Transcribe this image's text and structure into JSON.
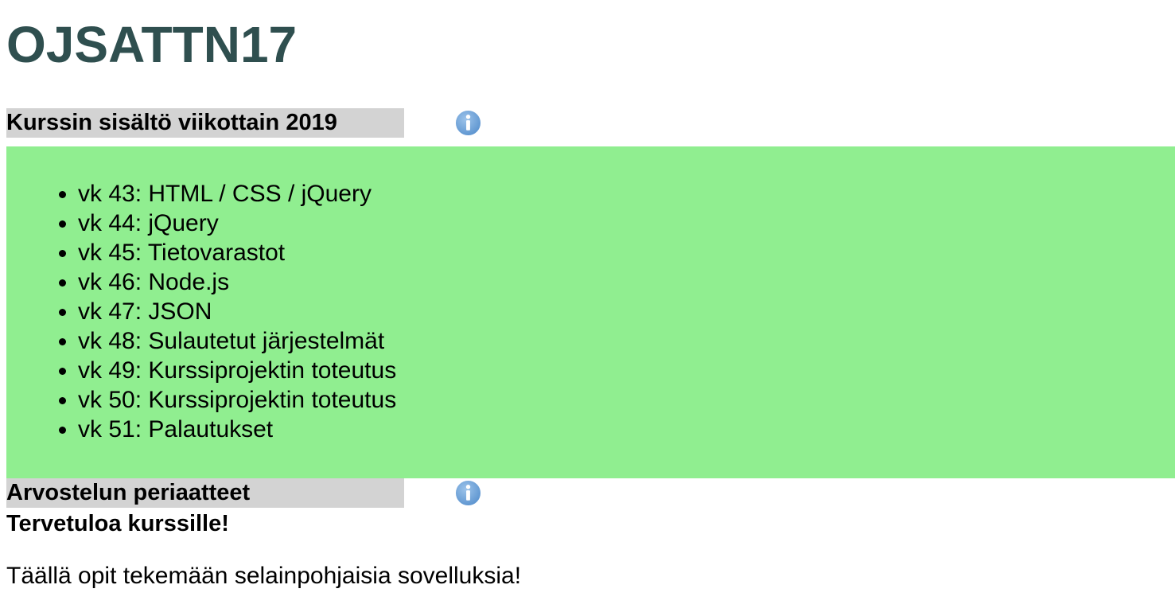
{
  "site": {
    "title": "OJSATTN17"
  },
  "sections": [
    {
      "title": "Kurssin sisältö viikottain 2019",
      "icon": "info-icon",
      "items": [
        "vk 43: HTML / CSS / jQuery",
        "vk 44: jQuery",
        "vk 45: Tietovarastot",
        "vk 46: Node.js",
        "vk 47: JSON",
        "vk 48: Sulautetut järjestelmät",
        "vk 49: Kurssiprojektin toteutus",
        "vk 50: Kurssiprojektin toteutus",
        "vk 51: Palautukset"
      ]
    },
    {
      "title": "Arvostelun periaatteet",
      "icon": "info-icon"
    }
  ],
  "welcome": {
    "heading": "Tervetuloa kurssille!",
    "text": "Täällä opit tekemään selainpohjaisia sovelluksia!"
  },
  "colors": {
    "title": "#2f4f4f",
    "header_bg": "#d3d3d3",
    "content_bg": "#90ee90",
    "icon_blue": "#6fa3d8"
  }
}
